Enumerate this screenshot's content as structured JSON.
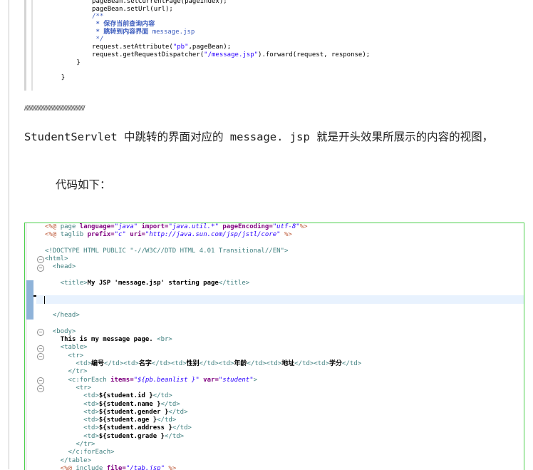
{
  "code_top": {
    "lines": [
      {
        "indent": "            ",
        "parts": [
          {
            "t": "pageBean.setCurrentPage(pageIndex);",
            "c": "plain"
          }
        ]
      },
      {
        "indent": "            ",
        "parts": [
          {
            "t": "pageBean.setUrl(url);",
            "c": "plain"
          }
        ]
      },
      {
        "indent": "            ",
        "parts": [
          {
            "t": "/**",
            "c": "cmt"
          }
        ]
      },
      {
        "indent": "             ",
        "parts": [
          {
            "t": "* 保存当前查询内容",
            "c": "cmtb"
          }
        ]
      },
      {
        "indent": "             ",
        "parts": [
          {
            "t": "* 跳转到内容界面 ",
            "c": "cmtb"
          },
          {
            "t": "message.jsp",
            "c": "cmt"
          }
        ]
      },
      {
        "indent": "             ",
        "parts": [
          {
            "t": "*/",
            "c": "cmt"
          }
        ]
      },
      {
        "indent": "            ",
        "parts": [
          {
            "t": "request.setAttribute(",
            "c": "plain"
          },
          {
            "t": "\"pb\"",
            "c": "str"
          },
          {
            "t": ",pageBean);",
            "c": "plain"
          }
        ]
      },
      {
        "indent": "            ",
        "parts": [
          {
            "t": "request.getRequestDispatcher(",
            "c": "plain"
          },
          {
            "t": "\"/message.jsp\"",
            "c": "str"
          },
          {
            "t": ").forward(request, response);",
            "c": "plain"
          }
        ]
      },
      {
        "indent": "        ",
        "parts": [
          {
            "t": "}",
            "c": "plain"
          }
        ]
      },
      {
        "indent": "",
        "parts": [
          {
            "t": "",
            "c": "plain"
          }
        ]
      },
      {
        "indent": "    ",
        "parts": [
          {
            "t": "}",
            "c": "plain"
          }
        ]
      }
    ]
  },
  "divider": "//////////////////////////////////////////////",
  "paragraph1": "StudentServlet  中跳转的界面对应的  message. jsp  就是开头效果所展示的内容的视图，",
  "paragraph2": "代码如下：",
  "code_bottom": {
    "lines": [
      {
        "parts": [
          {
            "t": "<%@ ",
            "c": "jsp"
          },
          {
            "t": "page ",
            "c": "tag"
          },
          {
            "t": "language=",
            "c": "attr"
          },
          {
            "t": "\"java\"",
            "c": "aval"
          },
          {
            "t": " import=",
            "c": "attr"
          },
          {
            "t": "\"java.util.*\"",
            "c": "aval"
          },
          {
            "t": " pageEncoding=",
            "c": "attr"
          },
          {
            "t": "\"utf-8\"",
            "c": "aval"
          },
          {
            "t": "%>",
            "c": "jsp"
          }
        ]
      },
      {
        "parts": [
          {
            "t": "<%@ ",
            "c": "jsp"
          },
          {
            "t": "taglib ",
            "c": "tag"
          },
          {
            "t": "prefix=",
            "c": "attr"
          },
          {
            "t": "\"c\"",
            "c": "aval"
          },
          {
            "t": " uri=",
            "c": "attr"
          },
          {
            "t": "\"http://java.sun.com/jsp/jstl/core\"",
            "c": "aval"
          },
          {
            "t": " %>",
            "c": "jsp"
          }
        ]
      },
      {
        "parts": [
          {
            "t": "",
            "c": "plain"
          }
        ]
      },
      {
        "parts": [
          {
            "t": "<!DOCTYPE HTML PUBLIC \"-//W3C//DTD HTML 4.01 Transitional//EN\">",
            "c": "doct"
          }
        ]
      },
      {
        "parts": [
          {
            "t": "<html>",
            "c": "tag"
          }
        ]
      },
      {
        "parts": [
          {
            "t": "  <head>",
            "c": "tag"
          }
        ]
      },
      {
        "parts": [
          {
            "t": "",
            "c": "plain"
          }
        ]
      },
      {
        "parts": [
          {
            "t": "    <title>",
            "c": "tag"
          },
          {
            "t": "My JSP 'message.jsp' starting page",
            "c": "bold"
          },
          {
            "t": "</title>",
            "c": "tag"
          }
        ]
      },
      {
        "parts": [
          {
            "t": "",
            "c": "plain"
          }
        ]
      },
      {
        "parts": [
          {
            "t": "",
            "c": "plain"
          }
        ]
      },
      {
        "parts": [
          {
            "t": "",
            "c": "plain"
          }
        ]
      },
      {
        "parts": [
          {
            "t": "  </head>",
            "c": "tag"
          }
        ]
      },
      {
        "parts": [
          {
            "t": "",
            "c": "plain"
          }
        ]
      },
      {
        "parts": [
          {
            "t": "  <body>",
            "c": "tag"
          }
        ]
      },
      {
        "parts": [
          {
            "t": "    ",
            "c": "plain"
          },
          {
            "t": "This is my message page. ",
            "c": "bold"
          },
          {
            "t": "<br>",
            "c": "tag"
          }
        ]
      },
      {
        "parts": [
          {
            "t": "    <table>",
            "c": "tag"
          }
        ]
      },
      {
        "parts": [
          {
            "t": "      <tr>",
            "c": "tag"
          }
        ]
      },
      {
        "parts": [
          {
            "t": "        <td>",
            "c": "tag"
          },
          {
            "t": "编号",
            "c": "bold"
          },
          {
            "t": "</td><td>",
            "c": "tag"
          },
          {
            "t": "名字",
            "c": "bold"
          },
          {
            "t": "</td><td>",
            "c": "tag"
          },
          {
            "t": "性别",
            "c": "bold"
          },
          {
            "t": "</td><td>",
            "c": "tag"
          },
          {
            "t": "年龄",
            "c": "bold"
          },
          {
            "t": "</td><td>",
            "c": "tag"
          },
          {
            "t": "地址",
            "c": "bold"
          },
          {
            "t": "</td><td>",
            "c": "tag"
          },
          {
            "t": "学分",
            "c": "bold"
          },
          {
            "t": "</td>",
            "c": "tag"
          }
        ]
      },
      {
        "parts": [
          {
            "t": "      </tr>",
            "c": "tag"
          }
        ]
      },
      {
        "parts": [
          {
            "t": "      <c:forEach ",
            "c": "tag"
          },
          {
            "t": "items=",
            "c": "attr"
          },
          {
            "t": "\"${pb.beanlist }\"",
            "c": "aval"
          },
          {
            "t": " var=",
            "c": "attr"
          },
          {
            "t": "\"student\"",
            "c": "aval"
          },
          {
            "t": ">",
            "c": "tag"
          }
        ]
      },
      {
        "parts": [
          {
            "t": "        <tr>",
            "c": "tag"
          }
        ]
      },
      {
        "parts": [
          {
            "t": "          <td>",
            "c": "tag"
          },
          {
            "t": "${student.id }",
            "c": "bold"
          },
          {
            "t": "</td>",
            "c": "tag"
          }
        ]
      },
      {
        "parts": [
          {
            "t": "          <td>",
            "c": "tag"
          },
          {
            "t": "${student.name }",
            "c": "bold"
          },
          {
            "t": "</td>",
            "c": "tag"
          }
        ]
      },
      {
        "parts": [
          {
            "t": "          <td>",
            "c": "tag"
          },
          {
            "t": "${student.gender }",
            "c": "bold"
          },
          {
            "t": "</td>",
            "c": "tag"
          }
        ]
      },
      {
        "parts": [
          {
            "t": "          <td>",
            "c": "tag"
          },
          {
            "t": "${student.age }",
            "c": "bold"
          },
          {
            "t": "</td>",
            "c": "tag"
          }
        ]
      },
      {
        "parts": [
          {
            "t": "          <td>",
            "c": "tag"
          },
          {
            "t": "${student.address }",
            "c": "bold"
          },
          {
            "t": "</td>",
            "c": "tag"
          }
        ]
      },
      {
        "parts": [
          {
            "t": "          <td>",
            "c": "tag"
          },
          {
            "t": "${student.grade }",
            "c": "bold"
          },
          {
            "t": "</td>",
            "c": "tag"
          }
        ]
      },
      {
        "parts": [
          {
            "t": "        </tr>",
            "c": "tag"
          }
        ]
      },
      {
        "parts": [
          {
            "t": "      </c:forEach>",
            "c": "tag"
          }
        ]
      },
      {
        "parts": [
          {
            "t": "    </table>",
            "c": "tag"
          }
        ]
      },
      {
        "parts": [
          {
            "t": "    <%@ ",
            "c": "jsp"
          },
          {
            "t": "include ",
            "c": "tag"
          },
          {
            "t": "file=",
            "c": "attr"
          },
          {
            "t": "\"/tab.jsp\"",
            "c": "aval"
          },
          {
            "t": " %>",
            "c": "jsp"
          }
        ]
      }
    ],
    "fold_markers": [
      "⊖",
      "⊖",
      "⊖",
      "⊖",
      "⊖",
      "⊖",
      "⊖"
    ]
  }
}
